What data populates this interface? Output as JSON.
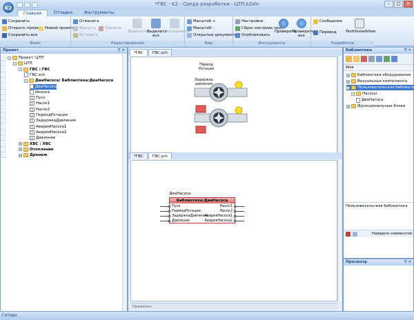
{
  "window": {
    "title": "*ГВС - K2 - Среда разработки - ЦТП.k2sln",
    "logo": "K2"
  },
  "ribbon_tabs": [
    "Главная",
    "Отладка",
    "Инструменты"
  ],
  "ribbon": {
    "file": {
      "label": "Файл",
      "items": [
        "Сохранить",
        "Открыть проект",
        "Новый проект",
        "Сохранить все"
      ]
    },
    "edit": {
      "label": "Редактирование",
      "items": [
        "Отменить",
        "Вернуть",
        "Удалить",
        "Вставить"
      ],
      "big": [
        "Вырезать",
        "Выделить все",
        "Копировать"
      ]
    },
    "view": {
      "label": "Вид",
      "items": [
        "Масштаб +",
        "Масштаб -",
        "Открытые документы"
      ]
    },
    "tools": {
      "label": "Инструменты",
      "items": [
        "Настройки",
        "Сброс настроек окон",
        "Опубликовать"
      ],
      "big": [
        "Проверить",
        "Проверить все"
      ]
    },
    "dev": {
      "label": "Разработка",
      "items": [
        "Сообщение",
        "Перевод"
      ],
      "big": "TestHostedView"
    }
  },
  "project": {
    "title": "Проект",
    "tree": [
      {
        "t": "Проект 'ЦТП'",
        "l": 0,
        "i": "fold",
        "e": "-"
      },
      {
        "t": "ЦТП",
        "l": 1,
        "i": "fold",
        "e": "-"
      },
      {
        "t": "ГВС : ГВС",
        "l": 2,
        "i": "fold",
        "e": "-",
        "b": true
      },
      {
        "t": "ГВС.sch",
        "l": 3,
        "i": "doc"
      },
      {
        "t": "ДваНасоса: Библиотека:ДваНасоса",
        "l": 3,
        "i": "fold",
        "e": "-",
        "b": true
      },
      {
        "t": "ДваНасоса",
        "l": 4,
        "i": "doc",
        "sel": true
      },
      {
        "t": "Иконка",
        "l": 4,
        "i": "doc"
      },
      {
        "t": "Пуск",
        "l": 4,
        "i": "grid"
      },
      {
        "t": "Насос1",
        "l": 4,
        "i": "grid"
      },
      {
        "t": "Насос2",
        "l": 4,
        "i": "grid"
      },
      {
        "t": "ПериодРотации",
        "l": 4,
        "i": "grid"
      },
      {
        "t": "ЗадержкаДавления",
        "l": 4,
        "i": "grid"
      },
      {
        "t": "АварияНасоса1",
        "l": 4,
        "i": "grid"
      },
      {
        "t": "АварияНасоса2",
        "l": 4,
        "i": "grid"
      },
      {
        "t": "Давление",
        "l": 4,
        "i": "grid"
      },
      {
        "t": "ХВС : ХВС",
        "l": 2,
        "i": "fold",
        "e": "+",
        "b": true
      },
      {
        "t": "Отопление",
        "l": 2,
        "i": "fold",
        "e": "+",
        "b": true
      },
      {
        "t": "Дренаж",
        "l": 2,
        "i": "fold",
        "e": "+",
        "b": true
      }
    ]
  },
  "doc_top": {
    "tabs": [
      "*ГВС",
      "ГВС.sch"
    ],
    "labels": {
      "period": "Период\nРотации",
      "delay": "Задержка\nдавления"
    }
  },
  "doc_bottom": {
    "tabs": [
      "*ГВС",
      "ГВС.sch"
    ],
    "footer": "Привязки",
    "block": {
      "name": "ДваНасоса",
      "type": "Библиотека:ДваНасоса",
      "inputs": [
        "Пуск",
        "ПериодРотации",
        "ЗадержкаДавления",
        "Давление"
      ],
      "outputs": [
        "Насос1",
        "Насос2",
        "АварияНасоса1",
        "АварияНасоса2"
      ]
    }
  },
  "library": {
    "title": "Библиотека",
    "column": "Имя",
    "tree": [
      {
        "t": "Библиотека оборудования",
        "l": 0,
        "e": "+"
      },
      {
        "t": "Визуальные компоненты",
        "l": 0,
        "e": "+"
      },
      {
        "t": "Пользовательская библиотека",
        "l": 0,
        "e": "-",
        "sel": true
      },
      {
        "t": "Насосы",
        "l": 1,
        "e": "-"
      },
      {
        "t": "ДваНасоса",
        "l": 2
      },
      {
        "t": "Функциональные блоки",
        "l": 0,
        "e": "+"
      }
    ],
    "footer": "Пользовательская библиотека",
    "search": "Найдено элементов"
  },
  "preview": {
    "title": "Просмотр"
  },
  "status": "Готово"
}
